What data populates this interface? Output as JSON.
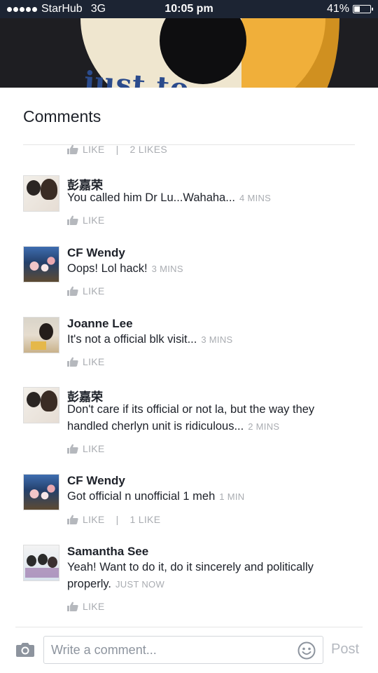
{
  "status_bar": {
    "carrier": "StarHub",
    "network": "3G",
    "time": "10:05 pm",
    "battery_percent": "41%",
    "battery_level": 0.41
  },
  "sheet": {
    "title": "Comments"
  },
  "top_like_row": {
    "like_label": "LIKE",
    "count_label": "2 LIKES"
  },
  "comments": [
    {
      "author": "彭嘉荣",
      "text": "You called him Dr Lu...Wahaha...",
      "time": "4 MINS",
      "like_label": "LIKE",
      "likes": ""
    },
    {
      "author": "CF Wendy",
      "text": "Oops! Lol hack!",
      "time": "3 MINS",
      "like_label": "LIKE",
      "likes": ""
    },
    {
      "author": "Joanne Lee",
      "text": "It's not a official blk visit...",
      "time": "3 MINS",
      "like_label": "LIKE",
      "likes": ""
    },
    {
      "author": "彭嘉荣",
      "text": "Don't care if its official or not la, but the way they handled cherlyn unit is ridiculous...",
      "time": "2 MINS",
      "like_label": "LIKE",
      "likes": ""
    },
    {
      "author": "CF Wendy",
      "text": "Got official n unofficial 1 meh",
      "time": "1 MIN",
      "like_label": "LIKE",
      "likes": "1 LIKE"
    },
    {
      "author": "Samantha See",
      "text": "Yeah! Want to do it, do it sincerely and politically properly.",
      "time": "JUST NOW",
      "like_label": "LIKE",
      "likes": ""
    }
  ],
  "composer": {
    "placeholder": "Write a comment...",
    "post_label": "Post",
    "camera_icon": "camera-icon",
    "emoji_icon": "smiley-icon"
  },
  "colors": {
    "status_bar_bg": "#1c2433",
    "meta_gray": "#a9acb1",
    "text_dark": "#1d2129"
  }
}
